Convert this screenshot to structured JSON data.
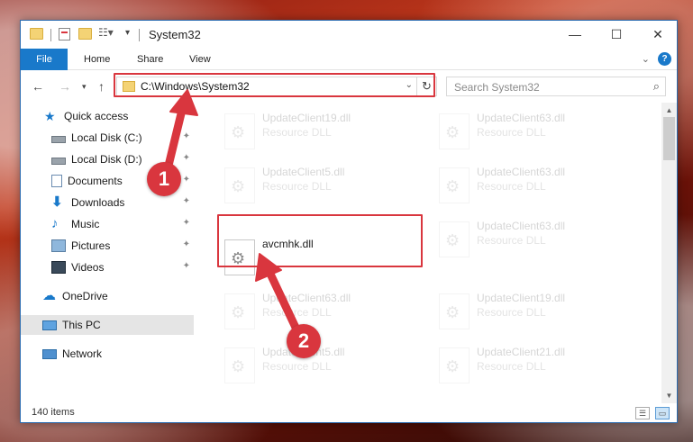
{
  "window": {
    "title": "System32",
    "controls": {
      "minimize": "—",
      "maximize": "☐",
      "close": "✕"
    }
  },
  "ribbon": {
    "tabs": [
      {
        "label": "File"
      },
      {
        "label": "Home"
      },
      {
        "label": "Share"
      },
      {
        "label": "View"
      }
    ],
    "help": "?"
  },
  "address": {
    "path": "C:\\Windows\\System32",
    "search_placeholder": "Search System32"
  },
  "sidebar": {
    "items": [
      {
        "label": "Quick access",
        "icon": "star-icon"
      },
      {
        "label": "Local Disk (C:)",
        "icon": "drive-icon",
        "pinned": true
      },
      {
        "label": "Local Disk (D:)",
        "icon": "drive-icon",
        "pinned": true
      },
      {
        "label": "Documents",
        "icon": "documents-icon",
        "pinned": true
      },
      {
        "label": "Downloads",
        "icon": "download-icon",
        "pinned": true
      },
      {
        "label": "Music",
        "icon": "music-icon",
        "pinned": true
      },
      {
        "label": "Pictures",
        "icon": "pictures-icon",
        "pinned": true
      },
      {
        "label": "Videos",
        "icon": "videos-icon",
        "pinned": true
      },
      {
        "label": "OneDrive",
        "icon": "cloud-icon"
      },
      {
        "label": "This PC",
        "icon": "computer-icon",
        "selected": true
      },
      {
        "label": "Network",
        "icon": "network-icon"
      }
    ]
  },
  "files": {
    "highlighted": {
      "name": "avcmhk.dll"
    },
    "left_column": [
      {
        "name": "UpdateClient19.dll",
        "type": "Resource DLL"
      },
      {
        "name": "UpdateClient5.dll",
        "type": "Resource DLL"
      },
      {
        "name": "UpdateClient63.dll",
        "type": "Resource DLL"
      },
      {
        "name": "UpdateClient5.dll",
        "type": "Resource DLL"
      }
    ],
    "right_column": [
      {
        "name": "UpdateClient63.dll",
        "type": "Resource DLL"
      },
      {
        "name": "UpdateClient63.dll",
        "type": "Resource DLL"
      },
      {
        "name": "UpdateClient63.dll",
        "type": "Resource DLL"
      },
      {
        "name": "UpdateClient19.dll",
        "type": "Resource DLL"
      },
      {
        "name": "UpdateClient21.dll",
        "type": "Resource DLL"
      }
    ]
  },
  "status": {
    "item_count": "140 items"
  },
  "annotations": {
    "step1": "1",
    "step2": "2",
    "color": "#d9363e"
  }
}
